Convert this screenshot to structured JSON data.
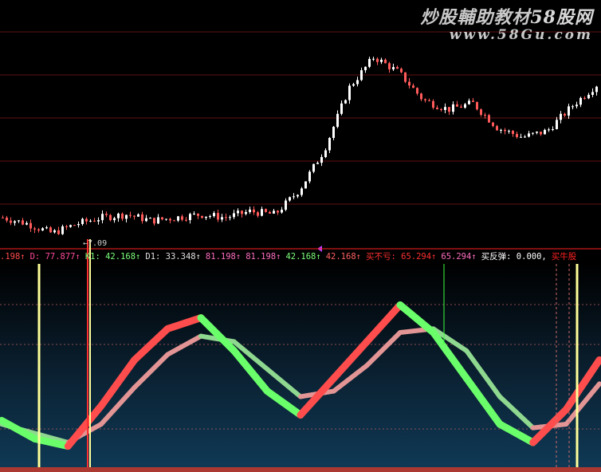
{
  "watermark": {
    "title_main": "炒股輔助教材",
    "title_brand": "58股网",
    "url": "www.58Gu.com"
  },
  "price_panel": {
    "min_price_label": "←7.09"
  },
  "indicator_row": {
    "items": [
      {
        "text": ".198↑",
        "color": "#ff4a4a"
      },
      {
        "text": "D: 77.877↑",
        "color": "#ff4a9a"
      },
      {
        "text": "K1: 42.168↑",
        "color": "#7cff7c"
      },
      {
        "text": "D1: 33.348↑",
        "color": "#e0e0e0"
      },
      {
        "text": "81.198↑",
        "color": "#ff6ec0"
      },
      {
        "text": "81.198↑",
        "color": "#ff6ec0"
      },
      {
        "text": "42.168↑",
        "color": "#7cff7c"
      },
      {
        "text": "42.168↑",
        "color": "#ff6060"
      },
      {
        "text": "买不亏: 65.294↑",
        "color": "#ff3030"
      },
      {
        "text": "65.294↑",
        "color": "#ff6ec0"
      },
      {
        "text": "买反弹: 0.000,",
        "color": "#ffffff"
      },
      {
        "text": "买牛股",
        "color": "#ff2020"
      }
    ]
  },
  "colors": {
    "candle_up": "#ffffff",
    "candle_down": "#ff5a5a",
    "grid": "#8a1a1a",
    "k_up_band": "#ff4d4d",
    "k_down_band": "#6aff6a",
    "d_up_band": "#e39595",
    "d_down_band": "#8fd88f",
    "signal_line": "#ffff99",
    "buy_line": "#ff3030"
  },
  "chart_data": {
    "type": "candlestick-with-oscillator",
    "price": {
      "min_label": "7.09",
      "close_trend": [
        7.6,
        7.4,
        7.09,
        7.4,
        7.6,
        7.7,
        7.5,
        7.6,
        7.7,
        7.6,
        7.8,
        7.7,
        8.5,
        9.8,
        11.8,
        12.8,
        12.3,
        11.4,
        11.1,
        11.3,
        10.5,
        10.2,
        10.4,
        11.2,
        11.9
      ]
    },
    "oscillator": {
      "k_values": [
        22,
        12,
        8,
        30,
        55,
        72,
        78,
        60,
        38,
        25,
        45,
        65,
        85,
        70,
        45,
        20,
        10,
        28,
        55
      ],
      "d_values": [
        20,
        15,
        10,
        20,
        40,
        58,
        68,
        65,
        50,
        35,
        38,
        52,
        70,
        72,
        60,
        35,
        18,
        20,
        42
      ]
    }
  }
}
